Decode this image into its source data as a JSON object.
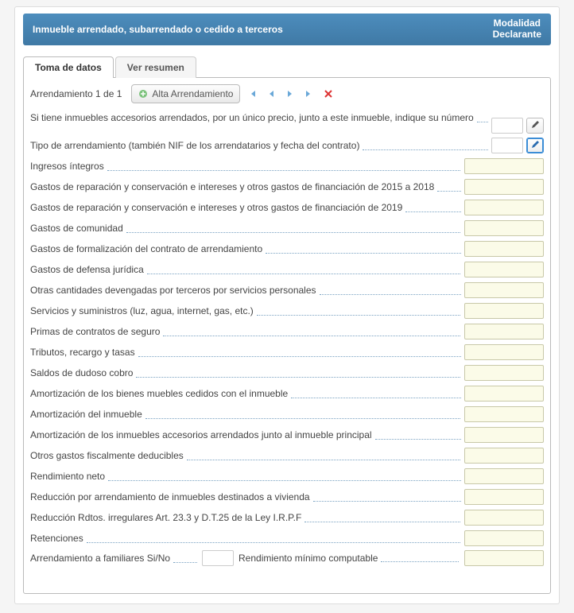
{
  "header": {
    "title": "Inmueble arrendado, subarrendado o cedido a terceros",
    "right_line1": "Modalidad",
    "right_line2": "Declarante"
  },
  "tabs": {
    "active": "Toma de datos",
    "inactive": "Ver resumen"
  },
  "toolbar": {
    "record_label": "Arrendamiento 1 de 1",
    "new_button": "Alta Arrendamiento"
  },
  "rows": {
    "r_accesorios": "Si tiene inmuebles accesorios arrendados, por un único precio, junto a este inmueble, indique su número",
    "r_tipo": "Tipo de arrendamiento (también NIF de los arrendatarios y fecha del contrato)",
    "r_ingresos": "Ingresos íntegros",
    "r_gastos1518": "Gastos de reparación y conservación e intereses y otros gastos de financiación de 2015 a 2018",
    "r_gastos19": "Gastos de reparación y conservación e intereses y otros gastos de financiación de 2019",
    "r_comunidad": "Gastos de comunidad",
    "r_formalizacion": "Gastos de formalización del contrato de arrendamiento",
    "r_defensa": "Gastos de defensa jurídica",
    "r_terceros": "Otras cantidades devengadas por terceros por servicios personales",
    "r_suministros": "Servicios y suministros (luz, agua, internet, gas, etc.)",
    "r_primas": "Primas de contratos de seguro",
    "r_tributos": "Tributos, recargo y tasas",
    "r_dudoso": "Saldos de dudoso cobro",
    "r_amortbienes": "Amortización de los bienes muebles cedidos con el inmueble",
    "r_amortinm": "Amortización del inmueble",
    "r_amortacc": "Amortización de los inmuebles accesorios arrendados junto al inmueble principal",
    "r_otros": "Otros gastos fiscalmente deducibles",
    "r_rendneto": "Rendimiento neto",
    "r_reducviv": "Reducción por arrendamiento de inmuebles destinados a vivienda",
    "r_reducirr": "Reducción Rdtos. irregulares Art. 23.3 y D.T.25 de la Ley I.R.P.F",
    "r_retenciones": "Retenciones",
    "r_familiares": "Arrendamiento a familiares Si/No",
    "r_rendmin": "Rendimiento mínimo computable"
  },
  "values": {
    "r_accesorios": "",
    "r_tipo": "",
    "r_ingresos": "",
    "r_gastos1518": "",
    "r_gastos19": "",
    "r_comunidad": "",
    "r_formalizacion": "",
    "r_defensa": "",
    "r_terceros": "",
    "r_suministros": "",
    "r_primas": "",
    "r_tributos": "",
    "r_dudoso": "",
    "r_amortbienes": "",
    "r_amortinm": "",
    "r_amortacc": "",
    "r_otros": "",
    "r_rendneto": "",
    "r_reducviv": "",
    "r_reducirr": "",
    "r_retenciones": "",
    "r_familiares": "",
    "r_rendmin": ""
  }
}
